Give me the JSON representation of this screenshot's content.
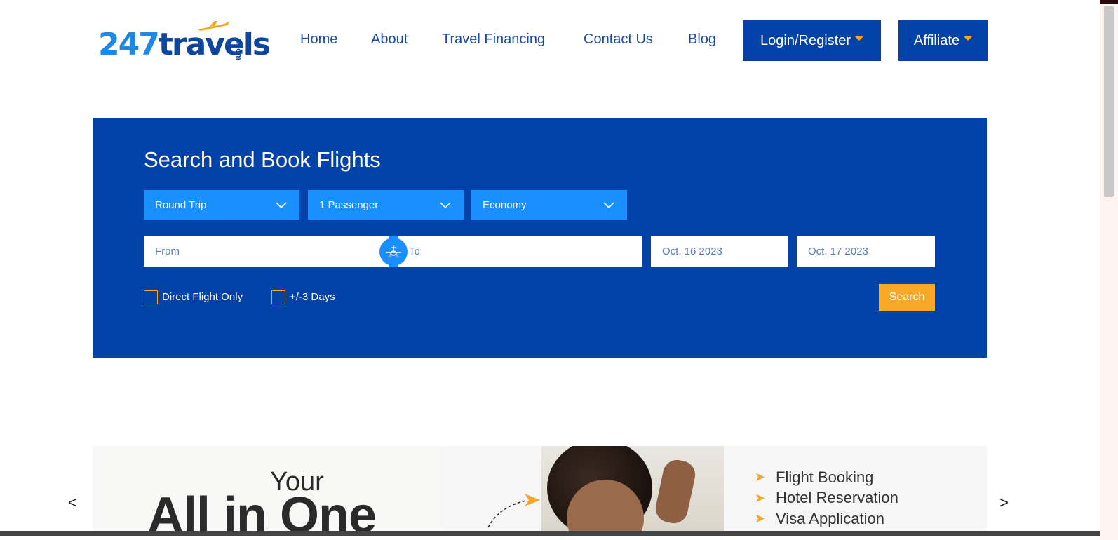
{
  "brand": {
    "logo_number": "24",
    "logo_seven": "7",
    "logo_word": "travels",
    "logo_suffix": ".com"
  },
  "nav": {
    "links": [
      "Home",
      "About",
      "Travel Financing",
      "Contact Us",
      "Blog"
    ],
    "login_label": "Login/Register",
    "affiliate_label": "Affiliate"
  },
  "search": {
    "title": "Search and Book Flights",
    "trip_type": "Round Trip",
    "passengers": "1 Passenger",
    "cabin_class": "Economy",
    "from_placeholder": "From",
    "to_placeholder": "To",
    "depart_date": "Oct, 16 2023",
    "return_date": "Oct, 17 2023",
    "direct_flight_label": "Direct Flight Only",
    "flex_days_label": "+/-3 Days",
    "search_label": "Search"
  },
  "carousel": {
    "headline_small": "Your",
    "headline_big": "All in One",
    "services": [
      "Flight Booking",
      "Hotel Reservation",
      "Visa Application"
    ],
    "prev_label": "<",
    "next_label": ">"
  },
  "colors": {
    "brand_blue": "#0342a8",
    "light_blue": "#1890ff",
    "accent_orange": "#f8a827"
  }
}
